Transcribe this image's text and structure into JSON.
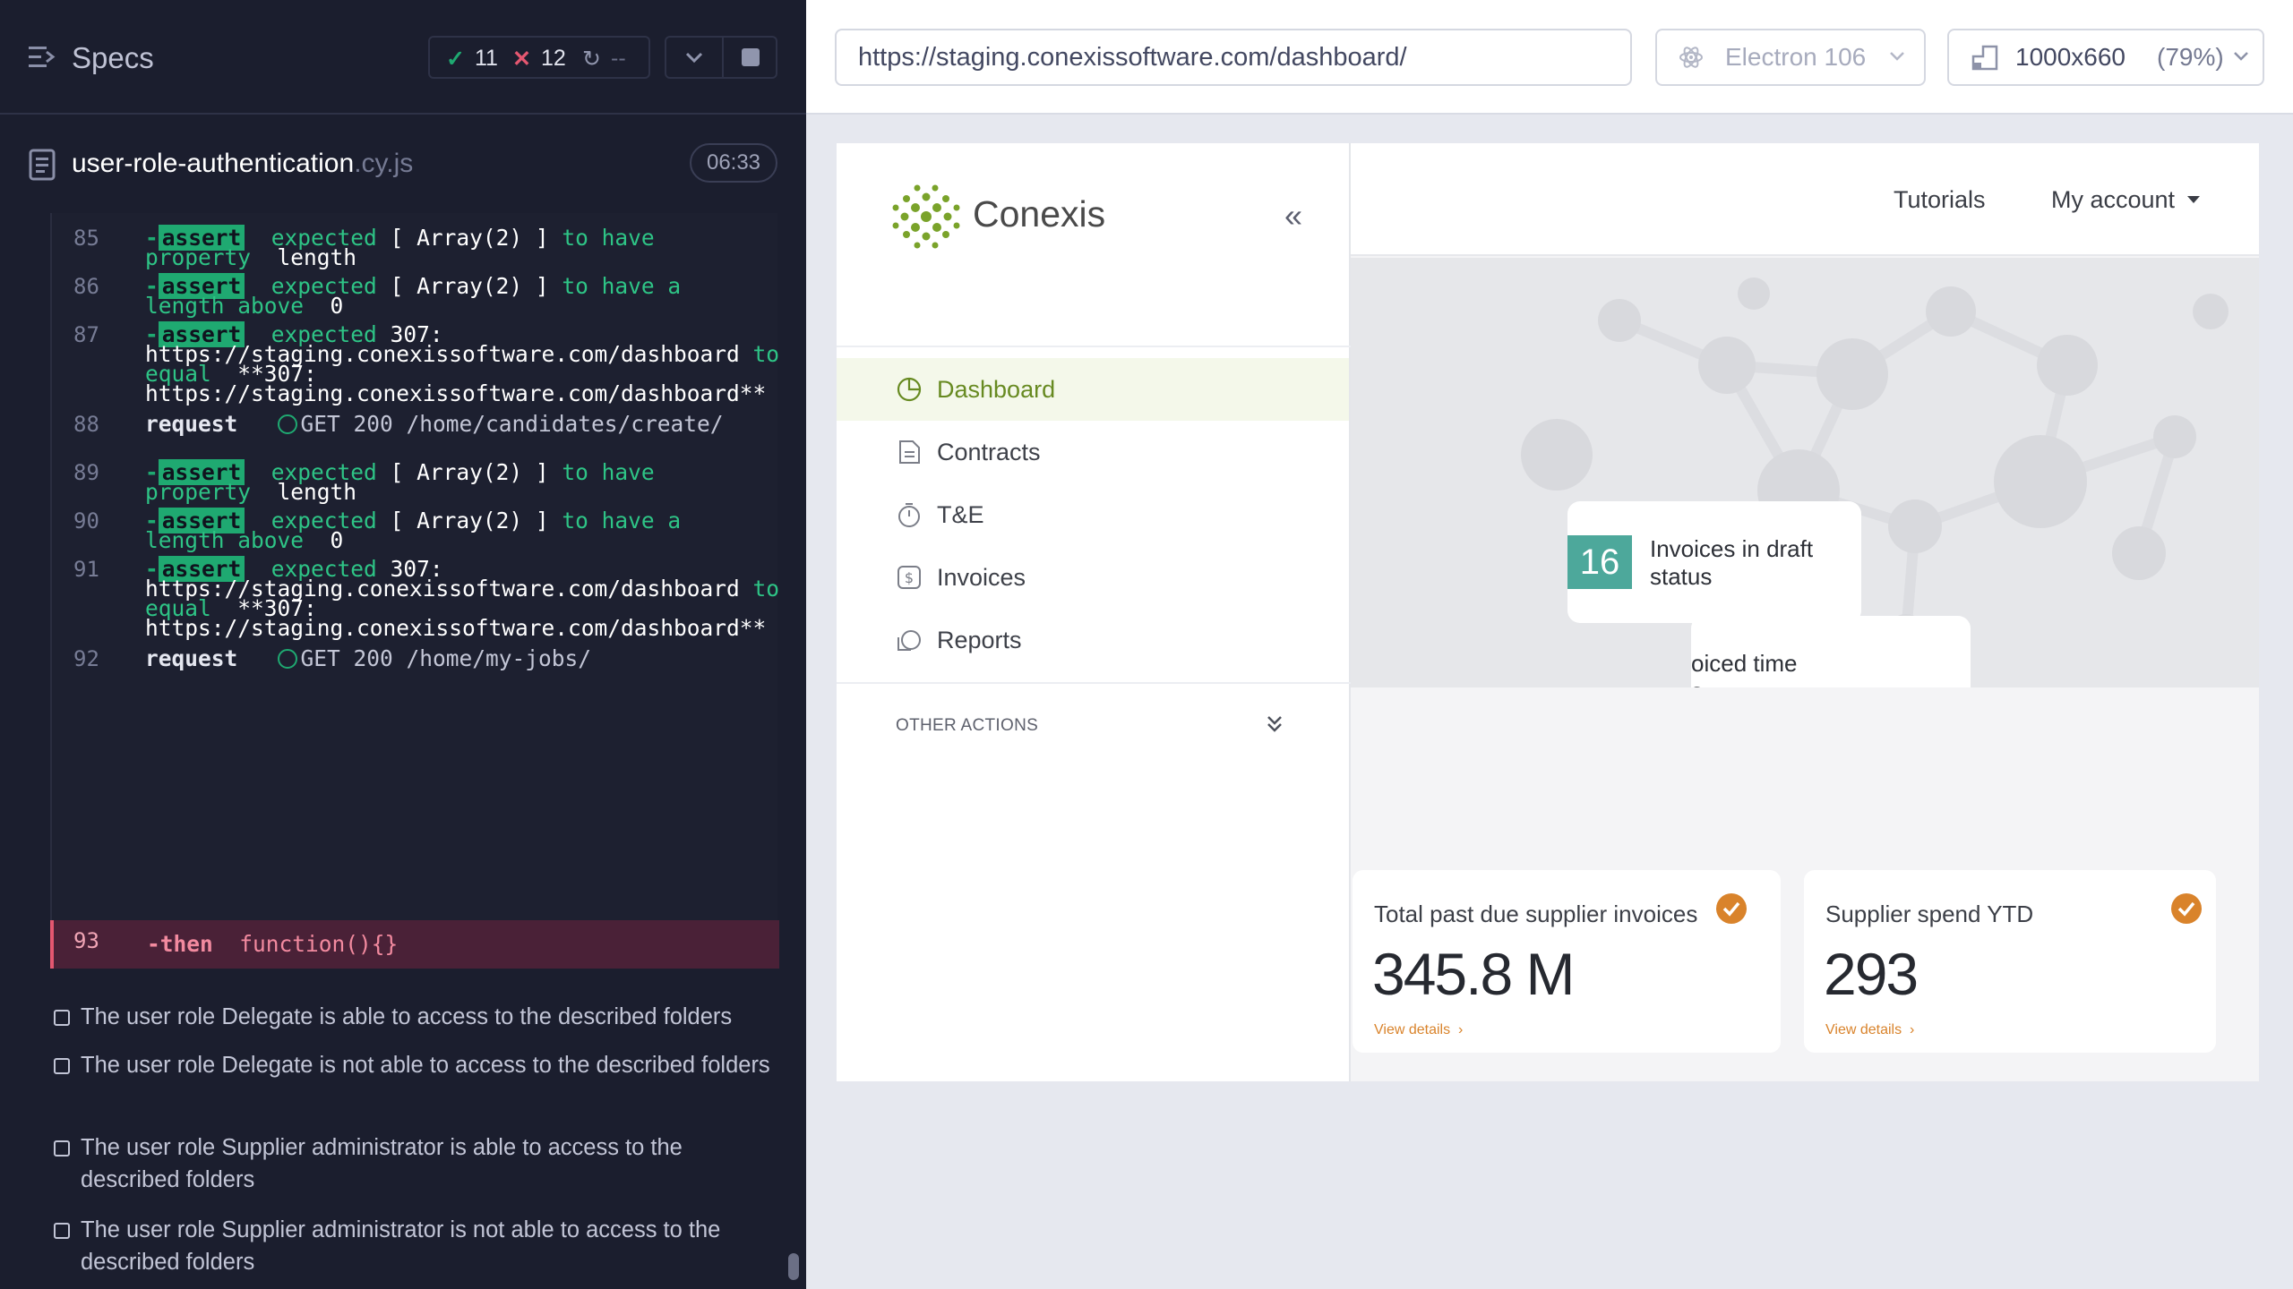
{
  "cypress": {
    "specs_title": "Specs",
    "stats": {
      "passed": "11",
      "failed": "12",
      "pending": "--"
    },
    "spec_file": {
      "name": "user-role-authentication",
      "ext": ".cy.js",
      "duration": "06:33"
    },
    "log": {
      "n85": "85",
      "n86": "86",
      "n87": "87",
      "n88": "88",
      "n89": "89",
      "n90": "90",
      "n91": "91",
      "n92": "92",
      "n93": "93",
      "dash": "-",
      "assert": "assert",
      "expected": "expected",
      "array2": "[ Array(2) ]",
      "to_have": "to have",
      "to_have_a": "to have a",
      "property": "property",
      "length": "length",
      "length_above": "length above",
      "zero": "0",
      "code307": "307:",
      "dashboard_url": "https://staging.conexissoftware.com/dashboard",
      "to": "to",
      "equal": "equal",
      "code307_bold": "**307:",
      "dashboard_url_bold": "https://staging.conexissoftware.com/dashboard**",
      "request": "request",
      "req88": "GET 200 /home/candidates/create/",
      "req92": "GET 200 /home/my-jobs/",
      "then": "-then",
      "then_arg": "function(){}"
    },
    "tests": [
      "The user role Delegate is able to access to the described folders",
      "The user role Delegate is not able to access to the described folders",
      "The user role Supplier administrator is able to access to the described folders",
      "The user role Supplier administrator is not able to access to the described folders"
    ]
  },
  "browser": {
    "url": "https://staging.conexissoftware.com/dashboard/",
    "browser_name": "Electron 106",
    "viewport": "1000x660",
    "zoom": "(79%)"
  },
  "app": {
    "logo_text": "Conexis",
    "collapse_label": "«",
    "nav": [
      {
        "label": "Dashboard",
        "icon": "pie-chart-icon",
        "active": true
      },
      {
        "label": "Contracts",
        "icon": "document-icon"
      },
      {
        "label": "T&E",
        "icon": "stopwatch-icon"
      },
      {
        "label": "Invoices",
        "icon": "dollar-icon"
      },
      {
        "label": "Reports",
        "icon": "reports-icon"
      }
    ],
    "other_actions": "OTHER ACTIONS",
    "topbar": {
      "tutorials": "Tutorials",
      "account": "My account"
    },
    "tiles": {
      "uninvoiced_line1": "oiced time",
      "uninvoiced_line2": "s",
      "drafts_count": "16",
      "drafts_label": "Invoices in draft status"
    },
    "kpis": [
      {
        "title": "Total past due supplier invoices",
        "value": "345.8 M",
        "link": "View details"
      },
      {
        "title": "Supplier spend YTD",
        "value": "293",
        "link": "View details"
      }
    ]
  },
  "colors": {
    "pass": "#1fa971",
    "fail": "#e45770",
    "brand_green": "#7aa32a",
    "teal": "#4da89b",
    "orange": "#d9832b"
  }
}
